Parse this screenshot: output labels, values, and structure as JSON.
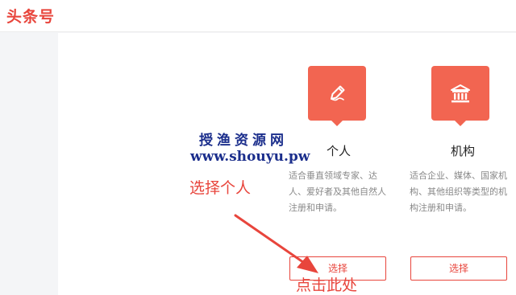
{
  "header": {
    "logo": "头条号"
  },
  "cards": [
    {
      "title": "个人",
      "description": "适合垂直领域专家、达人、爱好者及其他自然人注册和申请。",
      "button_label": "选择",
      "icon": "pencil-icon"
    },
    {
      "title": "机构",
      "description": "适合企业、媒体、国家机构、其他组织等类型的机构注册和申请。",
      "button_label": "选择",
      "icon": "institution-icon"
    }
  ],
  "watermark": {
    "line1": "授渔资源网",
    "line2": "www.shouyu.pw"
  },
  "annotations": {
    "choose_personal": "选择个人",
    "click_here": "点击此处"
  },
  "colors": {
    "brand": "#e8453c",
    "icon_bg": "#f26551",
    "watermark": "#1b2e8c",
    "desc_text": "#888888"
  }
}
